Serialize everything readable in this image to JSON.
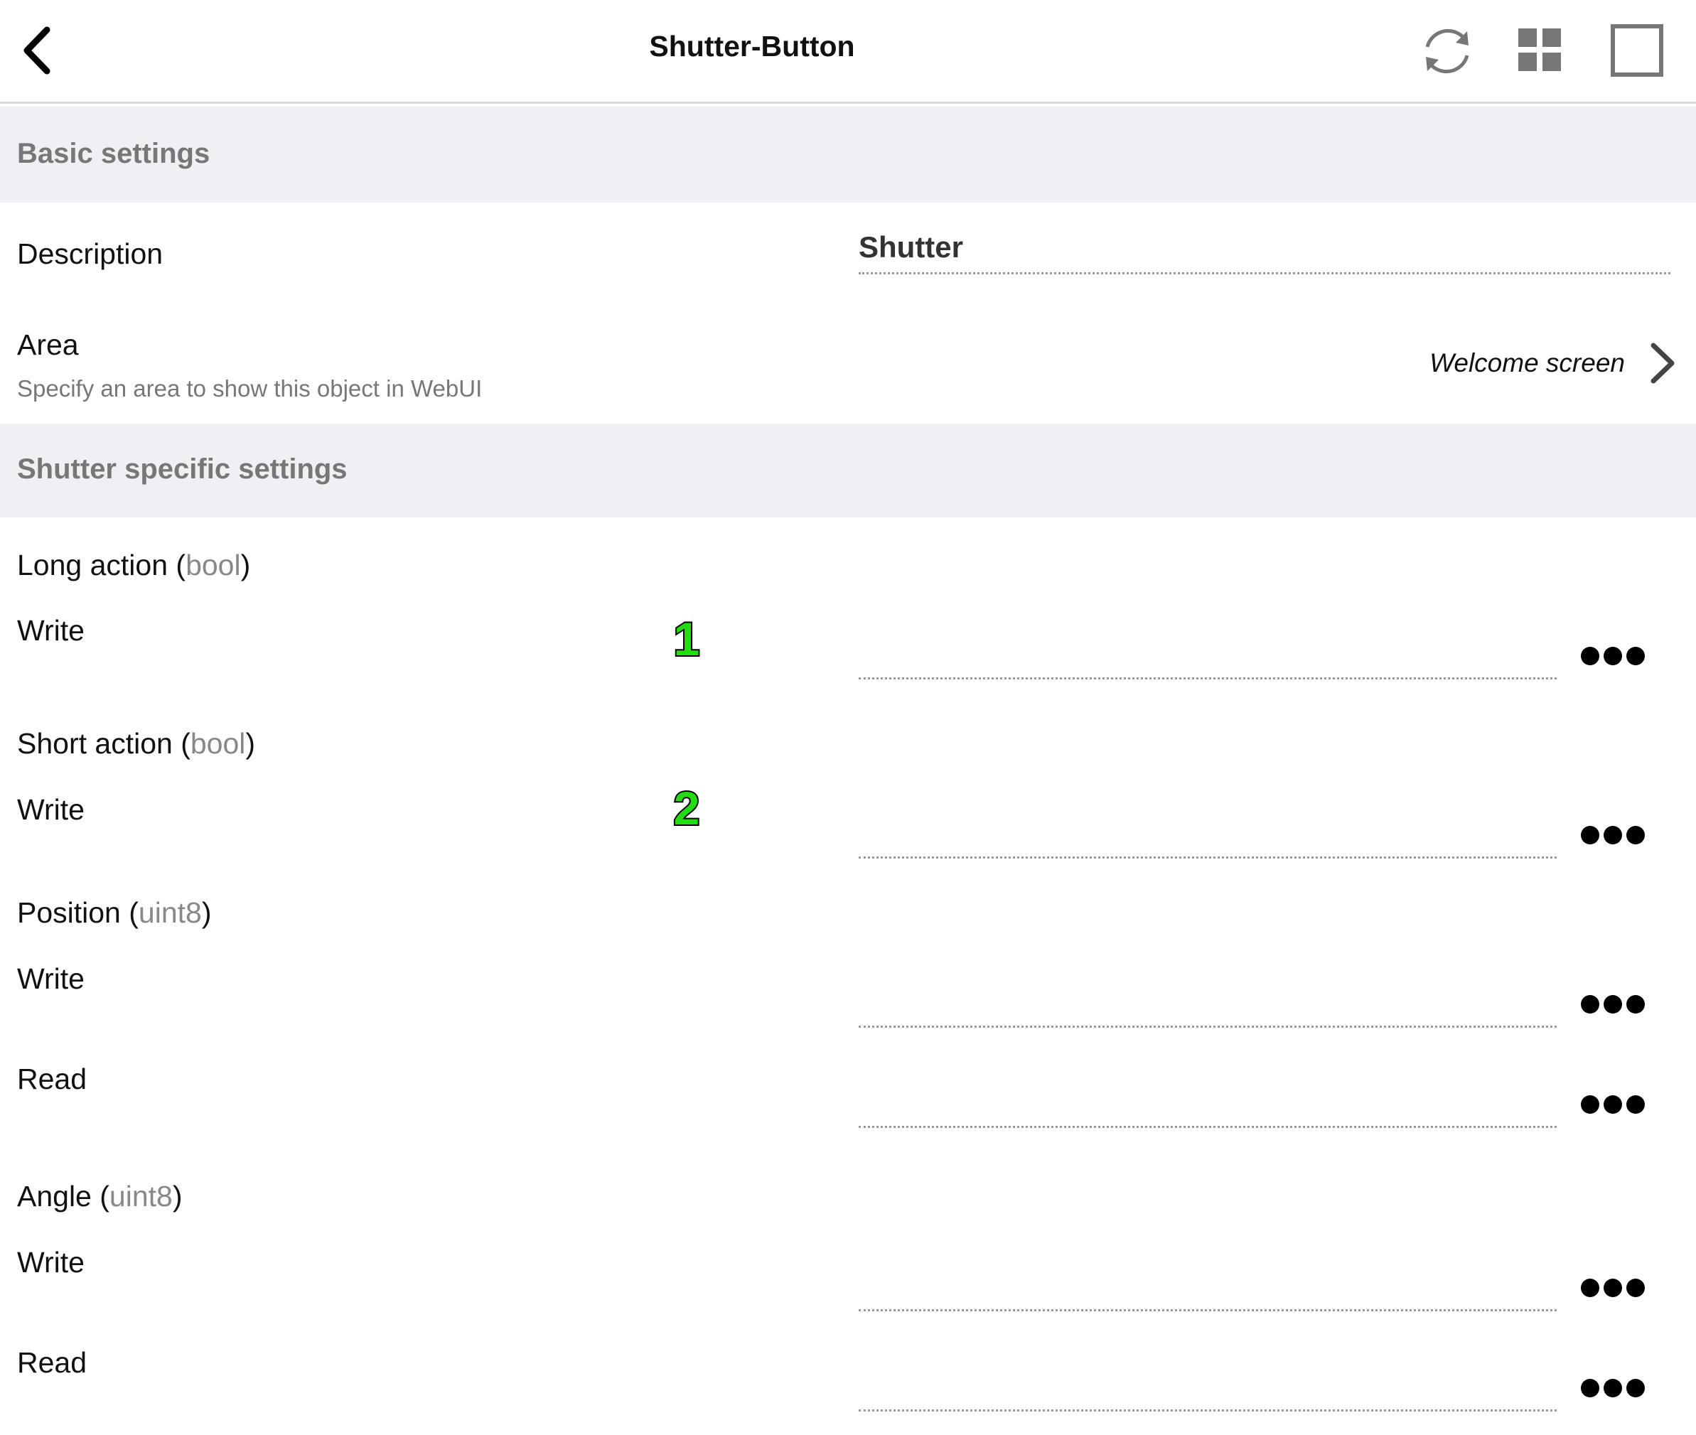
{
  "header": {
    "title": "Shutter-Button",
    "icons": [
      "back-chevron-icon",
      "refresh-icon",
      "grid-view-icon",
      "single-view-icon"
    ]
  },
  "basic": {
    "title": "Basic settings",
    "description": {
      "label": "Description",
      "value": "Shutter"
    },
    "area": {
      "label": "Area",
      "hint": "Specify an area to show this object in WebUI",
      "value": "Welcome screen"
    }
  },
  "shutter": {
    "title": "Shutter specific settings",
    "long_action": {
      "name": "Long action",
      "type": "bool",
      "write_label": "Write",
      "marker": "1"
    },
    "short_action": {
      "name": "Short action",
      "type": "bool",
      "write_label": "Write",
      "marker": "2"
    },
    "position": {
      "name": "Position",
      "type": "uint8",
      "write_label": "Write",
      "read_label": "Read"
    },
    "angle": {
      "name": "Angle",
      "type": "uint8",
      "write_label": "Write",
      "read_label": "Read"
    }
  },
  "colors": {
    "section_bg": "#efeff4",
    "section_text": "#777777",
    "type_hint": "#888888",
    "marker_fill": "#22dd11",
    "marker_outline": "#000000"
  }
}
